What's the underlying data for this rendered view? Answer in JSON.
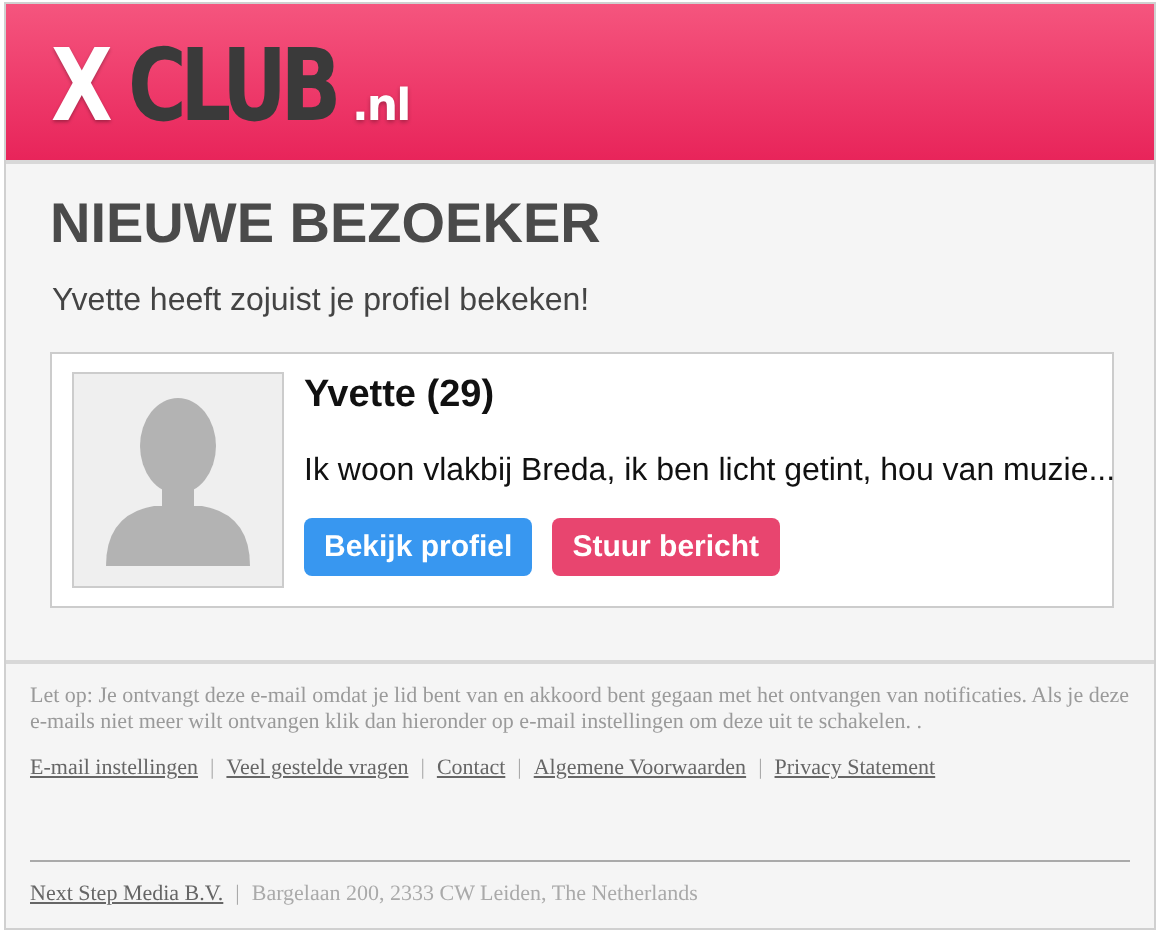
{
  "logo": {
    "parts": [
      {
        "text": "X",
        "kind": "light"
      },
      {
        "text": "CLUB",
        "kind": "dark"
      },
      {
        "text": ".nl",
        "kind": "suffix"
      }
    ]
  },
  "heading": "NIEUWE BEZOEKER",
  "subtitle": "Yvette heeft zojuist je profiel bekeken!",
  "profile": {
    "name": "Yvette (29)",
    "bio": "Ik woon vlakbij Breda, ik ben licht getint, hou van muzie...",
    "buttons": [
      {
        "label": "Bekijk profiel",
        "kind": "primary"
      },
      {
        "label": "Stuur bericht",
        "kind": "secondary"
      }
    ]
  },
  "footer": {
    "notice": "Let op: Je ontvangt deze e-mail omdat je lid bent van en akkoord bent gegaan met het ontvangen van notificaties. Als je deze e-mails niet meer wilt ontvangen klik dan hieronder op e-mail instellingen om deze uit te schakelen. .",
    "links": [
      "E-mail instellingen",
      "Veel gestelde vragen",
      "Contact",
      "Algemene Voorwaarden",
      "Privacy Statement"
    ],
    "separator": "|",
    "company": "Next Step Media B.V.",
    "address": "Bargelaan 200, 2333 CW Leiden, The Netherlands"
  }
}
